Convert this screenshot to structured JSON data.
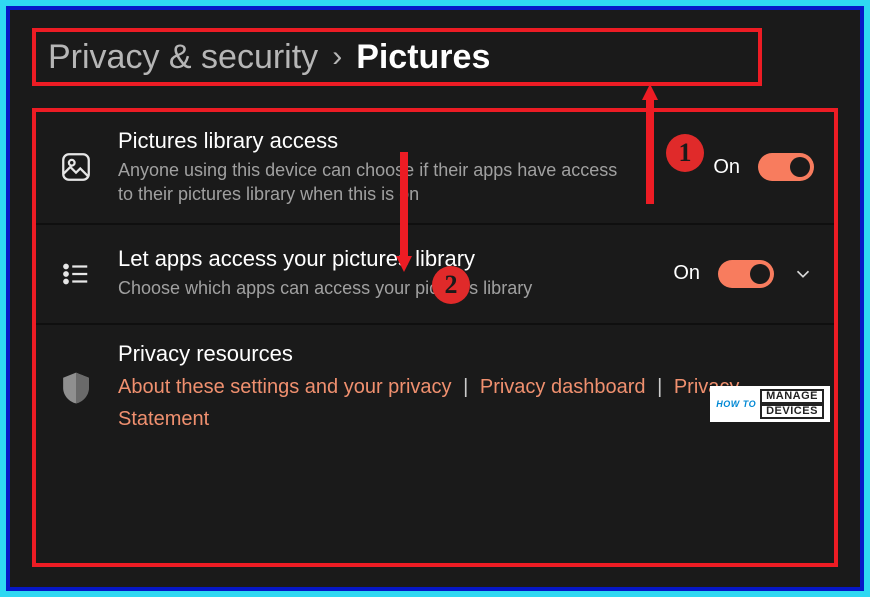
{
  "breadcrumb": {
    "parent": "Privacy & security",
    "separator": "›",
    "current": "Pictures"
  },
  "rows": {
    "library_access": {
      "title": "Pictures library access",
      "desc": "Anyone using this device can choose if their apps have access to their pictures library when this is on",
      "state_label": "On",
      "on": true
    },
    "let_apps": {
      "title": "Let apps access your pictures library",
      "desc": "Choose which apps can access your pictures library",
      "state_label": "On",
      "on": true
    },
    "resources": {
      "title": "Privacy resources",
      "link1": "About these settings and your privacy",
      "link2": "Privacy dashboard",
      "link3": "Privacy Statement",
      "sep": "|"
    }
  },
  "annotations": {
    "badge1": "1",
    "badge2": "2"
  },
  "watermark": {
    "how": "HOW TO",
    "manage": "MANAGE",
    "devices": "DEVICES"
  }
}
